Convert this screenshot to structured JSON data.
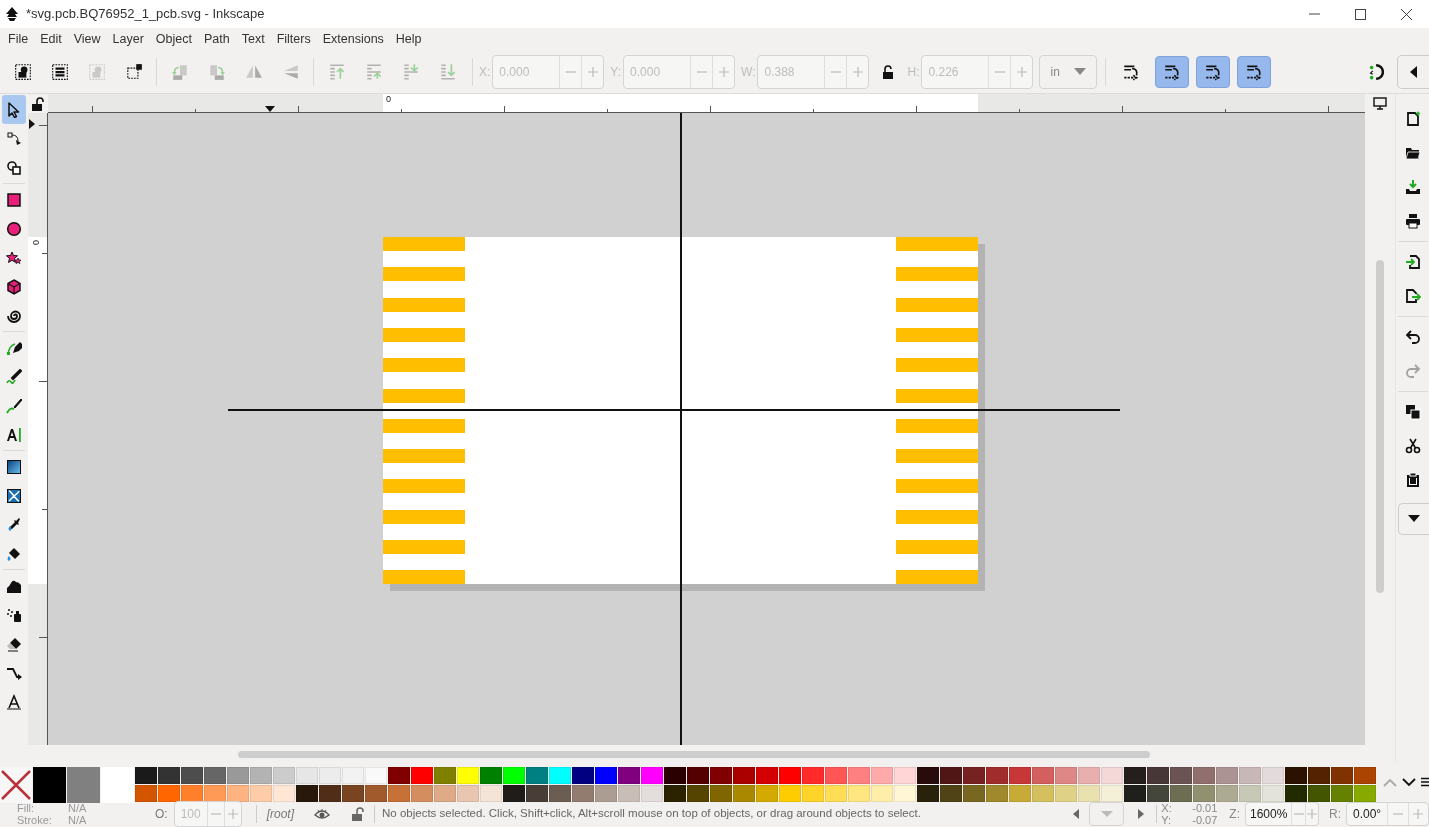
{
  "window": {
    "title": "*svg.pcb.BQ76952_1_pcb.svg - Inkscape"
  },
  "menu": [
    "File",
    "Edit",
    "View",
    "Layer",
    "Object",
    "Path",
    "Text",
    "Filters",
    "Extensions",
    "Help"
  ],
  "toolbar": {
    "buttons": [
      {
        "disabled": false
      },
      {
        "disabled": false
      },
      {
        "disabled": true
      },
      {
        "disabled": false
      },
      {
        "disabled": true
      },
      {
        "disabled": true
      },
      {
        "disabled": true
      },
      {
        "disabled": true
      },
      {
        "disabled": true
      },
      {
        "disabled": true
      },
      {
        "disabled": true
      },
      {
        "disabled": true
      }
    ],
    "fields": [
      {
        "label": "X:",
        "value": "0.000"
      },
      {
        "label": "Y:",
        "value": "0.000"
      },
      {
        "label": "W:",
        "value": "0.388"
      },
      {
        "label": "H:",
        "value": "0.226"
      }
    ],
    "unit": "in",
    "toggles": [
      {
        "selected": false
      },
      {
        "selected": true
      },
      {
        "selected": true
      },
      {
        "selected": true
      }
    ]
  },
  "rulers": {
    "horizontal_label": "0",
    "vertical_label": "0"
  },
  "tools": [
    {
      "selected": true
    },
    {
      "selected": false
    },
    {
      "selected": false
    },
    {
      "selected": false
    },
    {
      "selected": false
    },
    {
      "selected": false
    },
    {
      "selected": false
    },
    {
      "selected": false
    },
    {
      "selected": false
    },
    {
      "selected": false
    },
    {
      "selected": false
    },
    {
      "selected": false
    },
    {
      "selected": false
    },
    {
      "selected": false
    },
    {
      "selected": false
    },
    {
      "selected": false
    },
    {
      "selected": false
    },
    {
      "selected": false
    },
    {
      "selected": false
    },
    {
      "selected": false
    },
    {
      "selected": false
    }
  ],
  "commands": [
    {
      "disabled": false
    },
    {
      "disabled": false
    },
    {
      "disabled": false
    },
    {
      "disabled": false
    },
    {
      "disabled": false
    },
    {
      "disabled": false
    },
    {
      "disabled": false
    },
    {
      "disabled": true
    },
    {
      "disabled": false
    },
    {
      "disabled": false
    },
    {
      "disabled": false
    }
  ],
  "palette": {
    "large": [
      {
        "color": "#000000"
      },
      {
        "color": "#808080"
      },
      {
        "color": "#ffffff"
      }
    ],
    "top": [
      {
        "color": "#1a1a1a"
      },
      {
        "color": "#333333"
      },
      {
        "color": "#4d4d4d"
      },
      {
        "color": "#666666"
      },
      {
        "color": "#999999"
      },
      {
        "color": "#b3b3b3"
      },
      {
        "color": "#cccccc"
      },
      {
        "color": "#e6e6e6"
      },
      {
        "color": "#ececec"
      },
      {
        "color": "#f2f2f2"
      },
      {
        "color": "#f9f9f9"
      },
      {
        "color": "#800000"
      },
      {
        "color": "#ff0000"
      },
      {
        "color": "#808000"
      },
      {
        "color": "#ffff00"
      },
      {
        "color": "#008000"
      },
      {
        "color": "#00ff00"
      },
      {
        "color": "#008080"
      },
      {
        "color": "#00ffff"
      },
      {
        "color": "#000080"
      },
      {
        "color": "#0000ff"
      },
      {
        "color": "#800080"
      },
      {
        "color": "#ff00ff"
      },
      {
        "color": "#2b0000"
      },
      {
        "color": "#550000"
      },
      {
        "color": "#800001"
      },
      {
        "color": "#aa0000"
      },
      {
        "color": "#d40000"
      },
      {
        "color": "#ff0001"
      },
      {
        "color": "#ff2a2a"
      },
      {
        "color": "#ff5555"
      },
      {
        "color": "#ff8080"
      },
      {
        "color": "#ffaaaa"
      },
      {
        "color": "#ffd5d5"
      },
      {
        "color": "#280b0b"
      },
      {
        "color": "#501616"
      },
      {
        "color": "#782121"
      },
      {
        "color": "#a02c2c"
      },
      {
        "color": "#c83737"
      },
      {
        "color": "#d35f5f"
      },
      {
        "color": "#de8787"
      },
      {
        "color": "#e9afaf"
      },
      {
        "color": "#f4d7d7"
      },
      {
        "color": "#241f1c"
      },
      {
        "color": "#483737"
      },
      {
        "color": "#6c5353"
      },
      {
        "color": "#916f6f"
      },
      {
        "color": "#ac9393"
      },
      {
        "color": "#c8b7b7"
      },
      {
        "color": "#e3dbdb"
      },
      {
        "color": "#2b1100"
      },
      {
        "color": "#552200"
      },
      {
        "color": "#803300"
      },
      {
        "color": "#aa4400"
      }
    ],
    "bottom": [
      {
        "color": "#d45500"
      },
      {
        "color": "#ff6600"
      },
      {
        "color": "#ff7f2a"
      },
      {
        "color": "#ff9955"
      },
      {
        "color": "#ffb380"
      },
      {
        "color": "#ffccaa"
      },
      {
        "color": "#ffe6d5"
      },
      {
        "color": "#28170b"
      },
      {
        "color": "#502d16"
      },
      {
        "color": "#784421"
      },
      {
        "color": "#a05a2c"
      },
      {
        "color": "#c87137"
      },
      {
        "color": "#d38d5f"
      },
      {
        "color": "#deaa87"
      },
      {
        "color": "#e9c6af"
      },
      {
        "color": "#f4e3d7"
      },
      {
        "color": "#1f1c1a"
      },
      {
        "color": "#483e37"
      },
      {
        "color": "#6c5d53"
      },
      {
        "color": "#917c6f"
      },
      {
        "color": "#ac9d93"
      },
      {
        "color": "#c8beb7"
      },
      {
        "color": "#e3dedb"
      },
      {
        "color": "#2b2200"
      },
      {
        "color": "#554400"
      },
      {
        "color": "#806600"
      },
      {
        "color": "#aa8800"
      },
      {
        "color": "#d4aa00"
      },
      {
        "color": "#ffcc00"
      },
      {
        "color": "#ffd42a"
      },
      {
        "color": "#ffdd55"
      },
      {
        "color": "#ffe680"
      },
      {
        "color": "#ffeeaa"
      },
      {
        "color": "#fff6d5"
      },
      {
        "color": "#28220b"
      },
      {
        "color": "#504416"
      },
      {
        "color": "#786721"
      },
      {
        "color": "#a0892c"
      },
      {
        "color": "#c8ab37"
      },
      {
        "color": "#d4c05f"
      },
      {
        "color": "#dfd287"
      },
      {
        "color": "#e9e1af"
      },
      {
        "color": "#f4f0d7"
      },
      {
        "color": "#1f1f1c"
      },
      {
        "color": "#45463b"
      },
      {
        "color": "#6c6d53"
      },
      {
        "color": "#91916f"
      },
      {
        "color": "#acaa93"
      },
      {
        "color": "#c8c8b7"
      },
      {
        "color": "#e3e3db"
      },
      {
        "color": "#222b00"
      },
      {
        "color": "#445500"
      },
      {
        "color": "#668000"
      },
      {
        "color": "#88aa00"
      }
    ]
  },
  "status": {
    "fill_label": "Fill:",
    "fill_value": "N/A",
    "stroke_label": "Stroke:",
    "stroke_value": "N/A",
    "opacity_label": "O:",
    "opacity_value": "100",
    "layer": "[root]",
    "message": "No objects selected. Click, Shift+click, Alt+scroll mouse on top of objects, or drag around objects to select.",
    "x_label": "X:",
    "x_value": "-0.01",
    "y_label": "Y:",
    "y_value": "-0.07",
    "zoom_label": "Z:",
    "zoom_value": "1600%",
    "rotation_label": "R:",
    "rotation_value": "0.00°"
  }
}
